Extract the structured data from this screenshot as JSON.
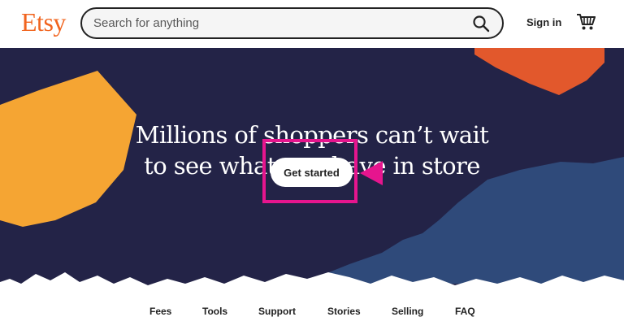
{
  "header": {
    "logo": "Etsy",
    "search_placeholder": "Search for anything",
    "sign_in": "Sign in"
  },
  "hero": {
    "headline_line1": "Millions of shoppers can’t wait",
    "headline_line2": "to see what you have in store",
    "cta_label": "Get started"
  },
  "nav": {
    "items": [
      "Fees",
      "Tools",
      "Support",
      "Stories",
      "Selling",
      "FAQ"
    ]
  },
  "colors": {
    "brand": "#f1641e",
    "hero_bg": "#232347",
    "highlight": "#e6158e",
    "blob_yellow": "#f5a533",
    "blob_orange": "#e2582c",
    "wave_blue": "#2f4a7a"
  },
  "icons": [
    "search-icon",
    "cart-icon",
    "pointer-arrow-icon"
  ]
}
